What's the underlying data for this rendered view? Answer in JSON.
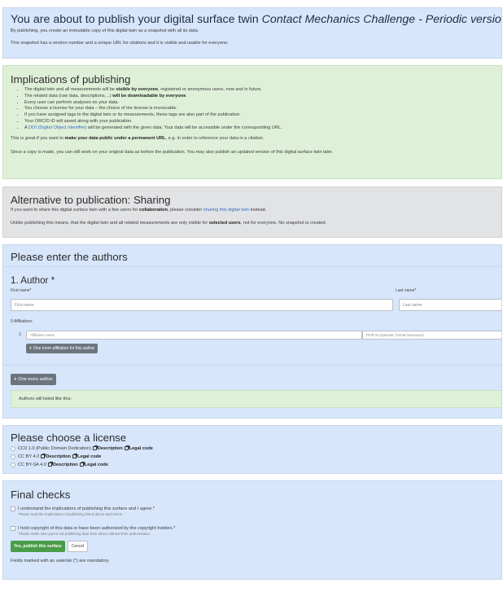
{
  "intro": {
    "title_prefix": "You are about to publish your digital surface twin",
    "title_surface": "Contact Mechanics Challenge - Periodic version",
    "line1": "By publishing, you create an immutable copy of this digital twin as a snapshot with all its data.",
    "line2": "This snapshot has a version number and a unique URL for citations and it is visible and usable for everyone."
  },
  "implications": {
    "heading": "Implications of publishing",
    "bullets": [
      {
        "pre": "The digital twin and all measurements will be ",
        "bold": "visible by everyone",
        "post": ", registered or anonymous users, now and in future."
      },
      {
        "pre": "The related data (raw data, descriptions, ..) ",
        "bold": "will be downloadable by everyone",
        "post": "."
      },
      {
        "pre": "Every user can perform analyses on your data.",
        "bold": "",
        "post": ""
      },
      {
        "pre": "You choose a license for your data – the choice of the license is irrevocable.",
        "bold": "",
        "post": ""
      },
      {
        "pre": "If you have assigned tags to the digital twin or its measurements, these tags are also part of the publication.",
        "bold": "",
        "post": ""
      },
      {
        "pre": "Your ORCID iD will saved along with your publication.",
        "bold": "",
        "post": ""
      }
    ],
    "doi_pre": "A ",
    "doi_link": "DOI (Digital Object Identifier)",
    "doi_post": " will be generated with the given data. Your data will be accessible under the corresponding URL.",
    "great_pre": "This is great if you want to ",
    "great_bold": "make your data public under a permanent URL",
    "great_post": ", e.g. in order to reference your data in a citation.",
    "copy_note": "Since a copy is made, you can still work on your original data as before the publication. You may also publish an updated version of this digital surface twin later."
  },
  "sharing": {
    "heading": "Alternative to publication: Sharing",
    "line1_pre": "If you want to share this digital surface twin with a few users for ",
    "line1_bold": "collaboration",
    "line1_mid": ", please consider ",
    "line1_link": "sharing this digital twin",
    "line1_post": " instead.",
    "line2_pre": "Unlike publishing this means, that the digital twin and all related measurements are only visible for ",
    "line2_bold": "selected users",
    "line2_post": ", not for everyone. No snapshot is created."
  },
  "authors": {
    "heading": "Please enter the authors",
    "author_title": "1. Author *",
    "first_label": "First name*",
    "last_label": "Last name*",
    "first_placeholder": "First name",
    "last_placeholder": "Last name",
    "affiliations_label": "0 Affiliations",
    "aff_index": "1.",
    "aff_placeholder": "Affiliation name",
    "ror_placeholder": "ROR ID (optional, format 0xxxxxxxx)",
    "more_affiliation_button": "One more affiliation for this author",
    "more_author_button": "One more author",
    "listed_text": "Authors will listed like this:"
  },
  "license": {
    "heading": "Please choose a license",
    "options": [
      {
        "name": "CC0 1.0 (Public Domain Dedication)",
        "desc": "Description",
        "legal": "Legal code"
      },
      {
        "name": "CC BY 4.0",
        "desc": "Description",
        "legal": "Legal code"
      },
      {
        "name": "CC BY-SA 4.0",
        "desc": "Description",
        "legal": "Legal code"
      }
    ]
  },
  "final": {
    "heading": "Final checks",
    "check1": "I understand the implications of publishing this surface and I agree.*",
    "check1_hint": "Please read the implications of publishing listed above and check.",
    "check2": "I hold copyright of this data or have been authorized by the copyright holders.*",
    "check2_hint": "Please make sure you're not publishing data from others without their authorization.",
    "publish_button": "Yes, publish this surface",
    "cancel_button": "Cancel",
    "mandatory_note": "Fields marked with an asterisk (*) are mandatory."
  },
  "colors": {
    "blue_card": "#d7e6fb",
    "green_card": "#dff0d8",
    "gray_card": "#e2e3e5",
    "publish_green": "#4a9c48",
    "link_blue": "#3a6bc6"
  },
  "icons": [
    "plus-icon",
    "external-link-icon"
  ]
}
